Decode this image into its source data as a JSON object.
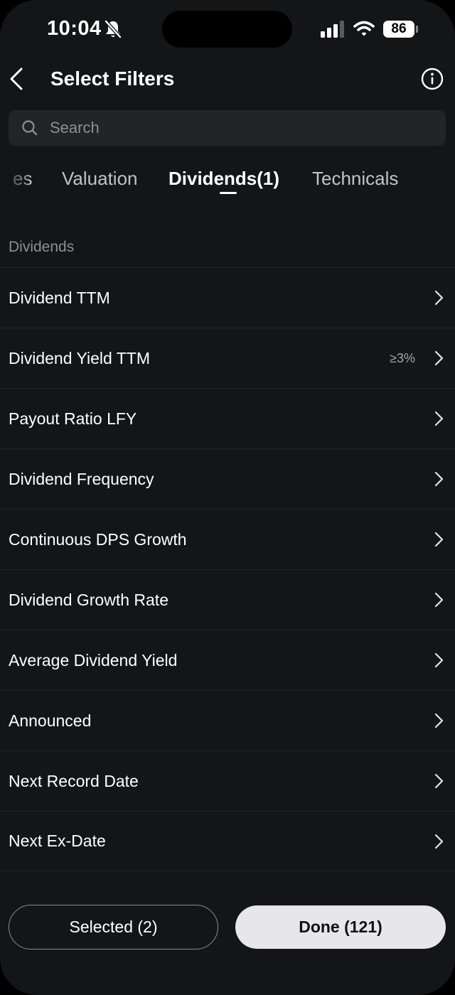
{
  "status_bar": {
    "time": "10:04",
    "battery": "86"
  },
  "header": {
    "title": "Select Filters"
  },
  "search": {
    "placeholder": "Search"
  },
  "tabs": [
    {
      "label": "es"
    },
    {
      "label": "Valuation"
    },
    {
      "label": "Dividends(1)",
      "active": true
    },
    {
      "label": "Technicals"
    }
  ],
  "section": {
    "title": "Dividends"
  },
  "filters": [
    {
      "label": "Dividend TTM",
      "value": ""
    },
    {
      "label": "Dividend Yield TTM",
      "value": "≥3%"
    },
    {
      "label": "Payout Ratio LFY",
      "value": ""
    },
    {
      "label": "Dividend Frequency",
      "value": ""
    },
    {
      "label": "Continuous DPS Growth",
      "value": ""
    },
    {
      "label": "Dividend Growth Rate",
      "value": ""
    },
    {
      "label": "Average Dividend Yield",
      "value": ""
    },
    {
      "label": "Announced",
      "value": ""
    },
    {
      "label": "Next Record Date",
      "value": ""
    },
    {
      "label": "Next Ex-Date",
      "value": ""
    }
  ],
  "footer": {
    "selected_label": "Selected (2)",
    "done_label": "Done (121)"
  }
}
